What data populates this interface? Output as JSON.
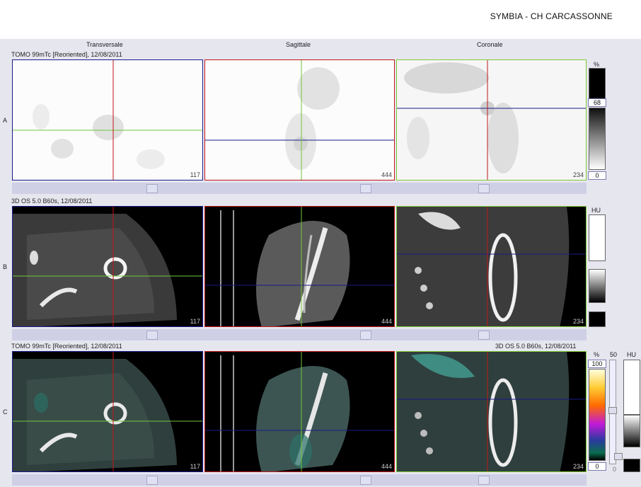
{
  "header": {
    "hospital": "SYMBIA - CH CARCASSONNE"
  },
  "columns": [
    "Transversale",
    "Sagittale",
    "Coronale"
  ],
  "rows": [
    {
      "letter": "A",
      "title": "TOMO 99mTc [Reoriented], 12/08/2011",
      "right_title": ""
    },
    {
      "letter": "B",
      "title": "3D  OS  5.0  B60s, 12/08/2011",
      "right_title": ""
    },
    {
      "letter": "C",
      "title": "TOMO 99mTc [Reoriented], 12/08/2011",
      "right_title": "3D  OS  5.0  B60s, 12/08/2011"
    }
  ],
  "slices": {
    "transversale": "117",
    "sagittale": "444",
    "coronale": "234"
  },
  "scales": {
    "a": {
      "unit": "%",
      "max": "68",
      "min": "0"
    },
    "b": {
      "unit": "HU"
    },
    "c": {
      "unit_left": "%",
      "max": "100",
      "min": "0",
      "mid": "50",
      "unit_right": "HU",
      "right_min": "0"
    }
  },
  "colors": {
    "transversale_frame": "#1a1a8a",
    "sagittale_frame": "#c01818",
    "coronale_frame": "#7ccc33"
  }
}
